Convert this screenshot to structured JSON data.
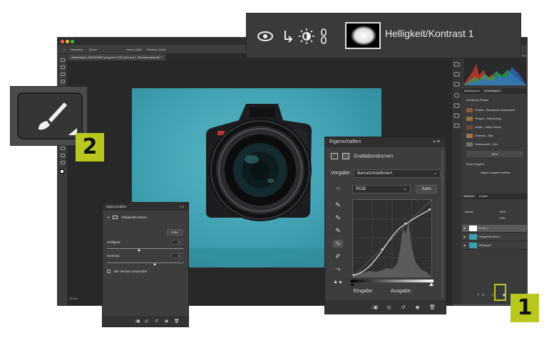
{
  "header": {
    "title": "Helligkeit/Kontrast 1",
    "icons": [
      "eye-icon",
      "clip-arrow-icon",
      "sun-icon",
      "chain-link-icon"
    ]
  },
  "main_window": {
    "options_bar": [
      "Verlaufsm.",
      "Ebene",
      "Ausw. Motiv",
      "Verbess. Kante"
    ],
    "document_tab": "Adobestock_2867960847.jpeg bei 12.5% (Kurven 1, Ebenenmaske/8) *",
    "zoom_status": "12.5%"
  },
  "right_panel": {
    "tabs_top": [
      "Bibliotheken",
      "Korrekturen"
    ],
    "adjustments_title": "Korrekturen Presets",
    "presets": [
      "Porträts – Klassisches Schwarzweiß",
      "Filmisch – Teilentonung",
      "Kreativ – Satter Farbton",
      "Erfahrbar – Blau",
      "Schwarzweiß – Kühl"
    ],
    "more_button": "Mehr",
    "single_adjustments": "Einzel-Vorgaben",
    "create_title": "Eigene Vorgaben erstellen",
    "layers_tabs": [
      "Ebenen",
      "Kanäle"
    ],
    "blend_mode": "Normal",
    "opacity": "100%",
    "fill": "100%",
    "layers": [
      {
        "name": "Kurven 1",
        "selected": true
      },
      {
        "name": "Helligkeit/Kontrast 1",
        "selected": false
      },
      {
        "name": "Hintergrund",
        "selected": false
      }
    ]
  },
  "badges": {
    "one": "1",
    "two": "2"
  },
  "props_small": {
    "title": "Eigenschaften",
    "subtitle": "Helligkeit/Kontrast",
    "auto_button": "Auto",
    "brightness_label": "Helligkeit:",
    "brightness_value": "-24",
    "brightness_level": 0.42,
    "contrast_label": "Kontrast:",
    "contrast_value": "34",
    "contrast_level": 0.62,
    "legacy_label": "Alte Version verwenden"
  },
  "props_curves": {
    "title": "Eigenschaften",
    "subtitle": "Gradationskurven",
    "preset_label": "Vorgabe:",
    "preset_value": "Benutzerdefiniert",
    "channel": "RGB",
    "auto_button": "Auto",
    "input_label": "Eingabe:",
    "output_label": "Ausgabe:"
  },
  "colors": {
    "accent": "#b9c81e",
    "panel": "#3d3d3d",
    "photo_bg": "#3ea0b1"
  }
}
